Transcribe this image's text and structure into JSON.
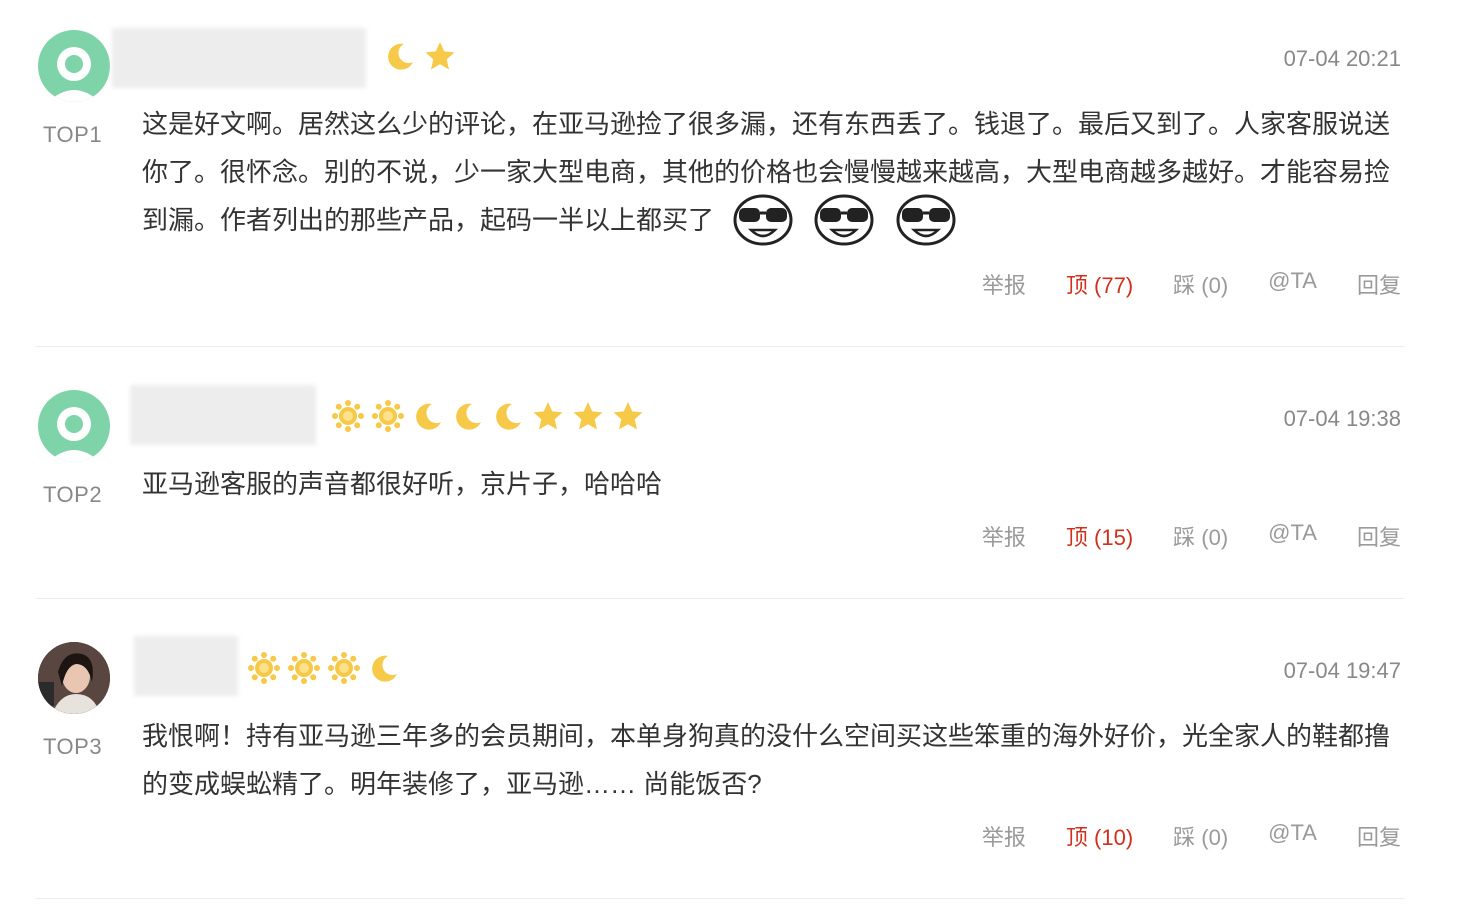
{
  "comments": [
    {
      "rank": "TOP1",
      "time": "07-04 20:21",
      "text": "这是好文啊。居然这么少的评论，在亚马逊捡了很多漏，还有东西丢了。钱退了。最后又到了。人家客服说送你了。很怀念。别的不说，少一家大型电商，其他的价格也会慢慢越来越高，大型电商越多越好。才能容易捡到漏。作者列出的那些产品，起码一半以上都买了",
      "badges": [
        "moon-icon",
        "star-icon"
      ],
      "emojis": [
        "sunglasses-emoji",
        "sunglasses-emoji",
        "sunglasses-emoji"
      ],
      "actions": {
        "report": "举报",
        "up": "顶 (77)",
        "down": "踩 (0)",
        "at": "@TA",
        "reply": "回复"
      }
    },
    {
      "rank": "TOP2",
      "time": "07-04 19:38",
      "text": "亚马逊客服的声音都很好听，京片子，哈哈哈",
      "badges": [
        "sun-icon",
        "sun-icon",
        "moon-icon",
        "moon-icon",
        "moon-icon",
        "star-icon",
        "star-icon",
        "star-icon"
      ],
      "actions": {
        "report": "举报",
        "up": "顶 (15)",
        "down": "踩 (0)",
        "at": "@TA",
        "reply": "回复"
      }
    },
    {
      "rank": "TOP3",
      "time": "07-04 19:47",
      "text": "我恨啊！持有亚马逊三年多的会员期间，本单身狗真的没什么空间买这些笨重的海外好价，光全家人的鞋都撸的变成蜈蚣精了。明年装修了，亚马逊…… 尚能饭否?",
      "badges": [
        "sun-icon",
        "sun-icon",
        "sun-icon",
        "moon-icon"
      ],
      "actions": {
        "report": "举报",
        "up": "顶 (10)",
        "down": "踩 (0)",
        "at": "@TA",
        "reply": "回复"
      }
    }
  ],
  "colors": {
    "badge_gold": "#f7c948",
    "upvote_red": "#d0301c",
    "avatar_green": "#7fd3a9",
    "muted_gray": "#888888"
  }
}
